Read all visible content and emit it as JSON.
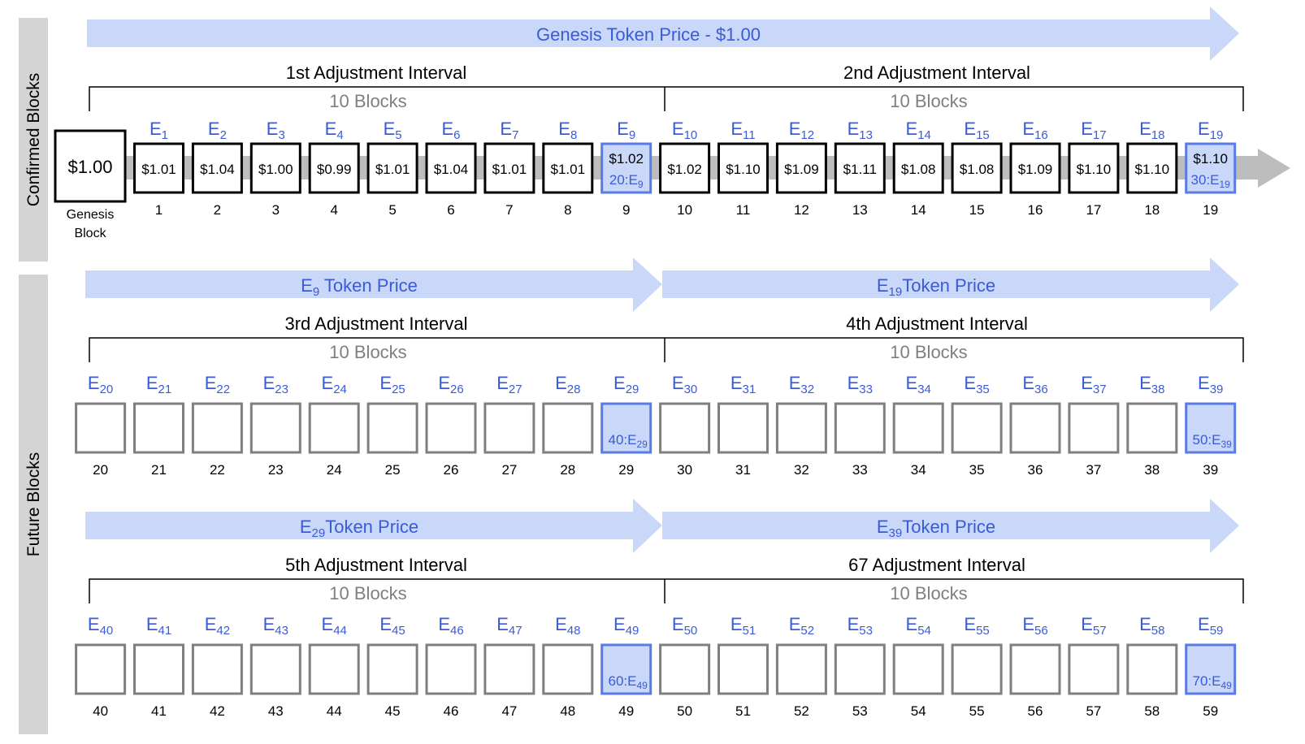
{
  "side_labels": {
    "confirmed": "Confirmed Blocks",
    "future": "Future Blocks"
  },
  "colors": {
    "arrow_fill": "#c9d7f8",
    "accent_text": "#3a5bd8",
    "highlight_fill": "#c9d7f8",
    "highlight_border": "#5a7ae6",
    "side_bar": "#d4d4d4",
    "chain_bar": "#bdbdbd",
    "future_border": "#7f7f7f",
    "interval_text": "#7f7f7f"
  },
  "genesis": {
    "price": "$1.00",
    "label_line1": "Genesis",
    "label_line2": "Block"
  },
  "rows": [
    {
      "arrows": [
        {
          "text": "Genesis Token Price - $1.00"
        }
      ],
      "intervals": [
        {
          "title": "1st Adjustment Interval",
          "sub": "10 Blocks"
        },
        {
          "title": "2nd Adjustment Interval",
          "sub": "10 Blocks"
        }
      ],
      "start": 1,
      "confirmed": true,
      "prices": [
        "$1.01",
        "$1.04",
        "$1.00",
        "$0.99",
        "$1.01",
        "$1.04",
        "$1.01",
        "$1.01",
        "$1.02",
        "$1.02",
        "$1.10",
        "$1.09",
        "$1.11",
        "$1.08",
        "$1.08",
        "$1.09",
        "$1.10",
        "$1.10",
        "$1.10"
      ],
      "highlights": {
        "9": "20:E9",
        "19": "30:E19"
      }
    },
    {
      "arrows": [
        {
          "text": "E9 Token Price"
        },
        {
          "text": "E19Token Price"
        }
      ],
      "intervals": [
        {
          "title": "3rd Adjustment Interval",
          "sub": "10 Blocks"
        },
        {
          "title": "4th Adjustment Interval",
          "sub": "10 Blocks"
        }
      ],
      "start": 20,
      "confirmed": false,
      "highlights": {
        "29": "40:E29",
        "39": "50:E39"
      }
    },
    {
      "arrows": [
        {
          "text": "E29Token Price"
        },
        {
          "text": "E39Token Price"
        }
      ],
      "intervals": [
        {
          "title": "5th Adjustment Interval",
          "sub": "10 Blocks"
        },
        {
          "title": "67 Adjustment Interval",
          "sub": "10 Blocks"
        }
      ],
      "start": 40,
      "confirmed": false,
      "highlights": {
        "49": "60:E49",
        "59": "70:E49"
      }
    }
  ]
}
